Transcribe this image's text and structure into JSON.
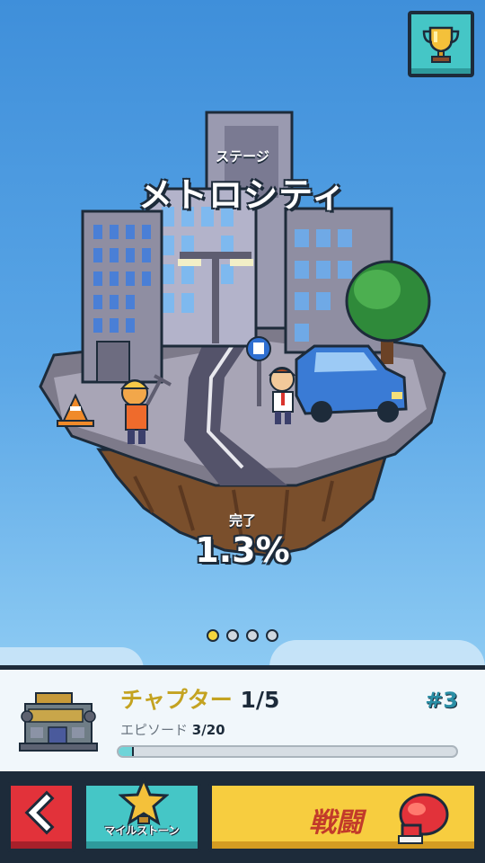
{
  "stage": {
    "label": "ステージ",
    "name": "メトロシティ"
  },
  "completion": {
    "label": "完了",
    "value": "1.3%"
  },
  "pager": {
    "count": 4,
    "active_index": 0
  },
  "chapter": {
    "title_label": "チャプター",
    "title_value": "1/5",
    "number": "#3",
    "episode_label": "エピソード",
    "episode_value": "3/20",
    "progress": 0.04
  },
  "actions": {
    "back_icon": "chevron-left-icon",
    "milestone_label": "マイルストーン",
    "fight_label": "戦闘"
  },
  "colors": {
    "accent_teal": "#45c6c6",
    "fight_yellow": "#f7cd3f",
    "back_red": "#e2323a",
    "outline": "#1d2b3a"
  }
}
